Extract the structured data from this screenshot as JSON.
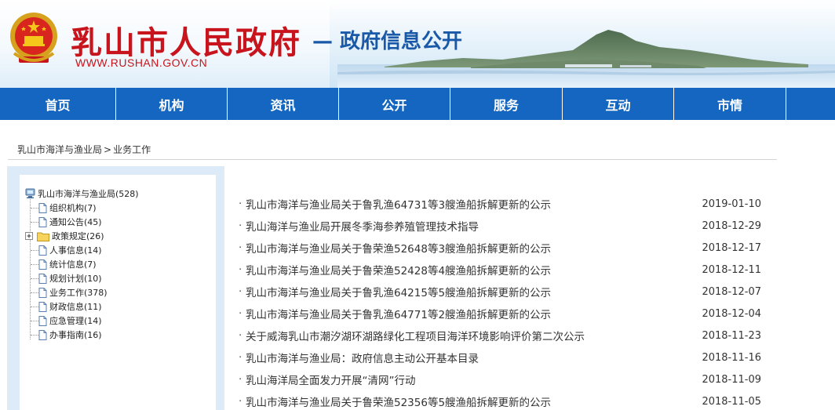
{
  "header": {
    "site_name": "乳山市人民政府",
    "site_sub": "— 政府信息公开",
    "site_url": "WWW.RUSHAN.GOV.CN"
  },
  "nav": {
    "items": [
      "首页",
      "机构",
      "资讯",
      "公开",
      "服务",
      "互动",
      "市情"
    ]
  },
  "breadcrumb": {
    "home": "乳山市海洋与渔业局",
    "separator": ">",
    "current": "业务工作"
  },
  "tree": {
    "root": "乳山市海洋与渔业局(528)",
    "expander": "+",
    "items": [
      "组织机构(7)",
      "通知公告(45)",
      "政策规定(26)",
      "人事信息(14)",
      "统计信息(7)",
      "规划计划(10)",
      "业务工作(378)",
      "财政信息(11)",
      "应急管理(14)",
      "办事指南(16)"
    ]
  },
  "articles": [
    {
      "title": "乳山市海洋与渔业局关于鲁乳渔64731等3艘渔船拆解更新的公示",
      "date": "2019-01-10"
    },
    {
      "title": "乳山海洋与渔业局开展冬季海参养殖管理技术指导",
      "date": "2018-12-29"
    },
    {
      "title": "乳山市海洋与渔业局关于鲁荣渔52648等3艘渔船拆解更新的公示",
      "date": "2018-12-17"
    },
    {
      "title": "乳山市海洋与渔业局关于鲁荣渔52428等4艘渔船拆解更新的公示",
      "date": "2018-12-11"
    },
    {
      "title": "乳山市海洋与渔业局关于鲁乳渔64215等5艘渔船拆解更新的公示",
      "date": "2018-12-07"
    },
    {
      "title": "乳山市海洋与渔业局关于鲁乳渔64771等2艘渔船拆解更新的公示",
      "date": "2018-12-04"
    },
    {
      "title": "关于威海乳山市潮汐湖环湖路绿化工程项目海洋环境影响评价第二次公示",
      "date": "2018-11-23"
    },
    {
      "title": "乳山市海洋与渔业局：政府信息主动公开基本目录",
      "date": "2018-11-16"
    },
    {
      "title": "乳山海洋局全面发力开展“清网”行动",
      "date": "2018-11-09"
    },
    {
      "title": "乳山市海洋与渔业局关于鲁荣渔52356等5艘渔船拆解更新的公示",
      "date": "2018-11-05"
    }
  ],
  "colors": {
    "brand_red": "#c8141c",
    "brand_blue": "#1466c0",
    "sidebar_bg": "#dcebf7"
  },
  "icons": [
    "national-emblem-icon",
    "computer-icon",
    "document-icon",
    "folder-icon",
    "expand-plus-icon"
  ]
}
